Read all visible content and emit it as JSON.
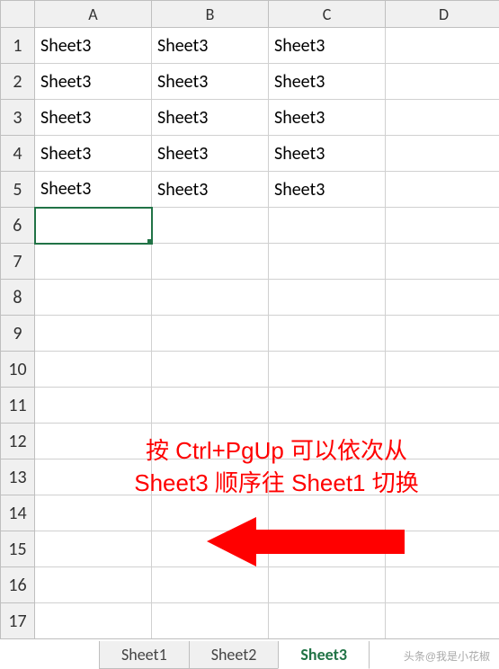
{
  "columns": [
    "A",
    "B",
    "C",
    "D"
  ],
  "rows": [
    1,
    2,
    3,
    4,
    5,
    6,
    7,
    8,
    9,
    10,
    11,
    12,
    13,
    14,
    15,
    16,
    17
  ],
  "cells": {
    "A1": "Sheet3",
    "B1": "Sheet3",
    "C1": "Sheet3",
    "A2": "Sheet3",
    "B2": "Sheet3",
    "C2": "Sheet3",
    "A3": "Sheet3",
    "B3": "Sheet3",
    "C3": "Sheet3",
    "A4": "Sheet3",
    "B4": "Sheet3",
    "C4": "Sheet3",
    "A5": "Sheet3",
    "B5": "Sheet3",
    "C5": "Sheet3"
  },
  "active_cell": "A6",
  "annotation": {
    "line1": "按 Ctrl+PgUp 可以依次从",
    "line2": "Sheet3 顺序往 Sheet1 切换"
  },
  "tabs": [
    {
      "label": "Sheet1",
      "active": false
    },
    {
      "label": "Sheet2",
      "active": false
    },
    {
      "label": "Sheet3",
      "active": true
    }
  ],
  "watermark": "头条@我是小花椒",
  "colors": {
    "accent": "#217346",
    "annotation": "#ff0000"
  }
}
